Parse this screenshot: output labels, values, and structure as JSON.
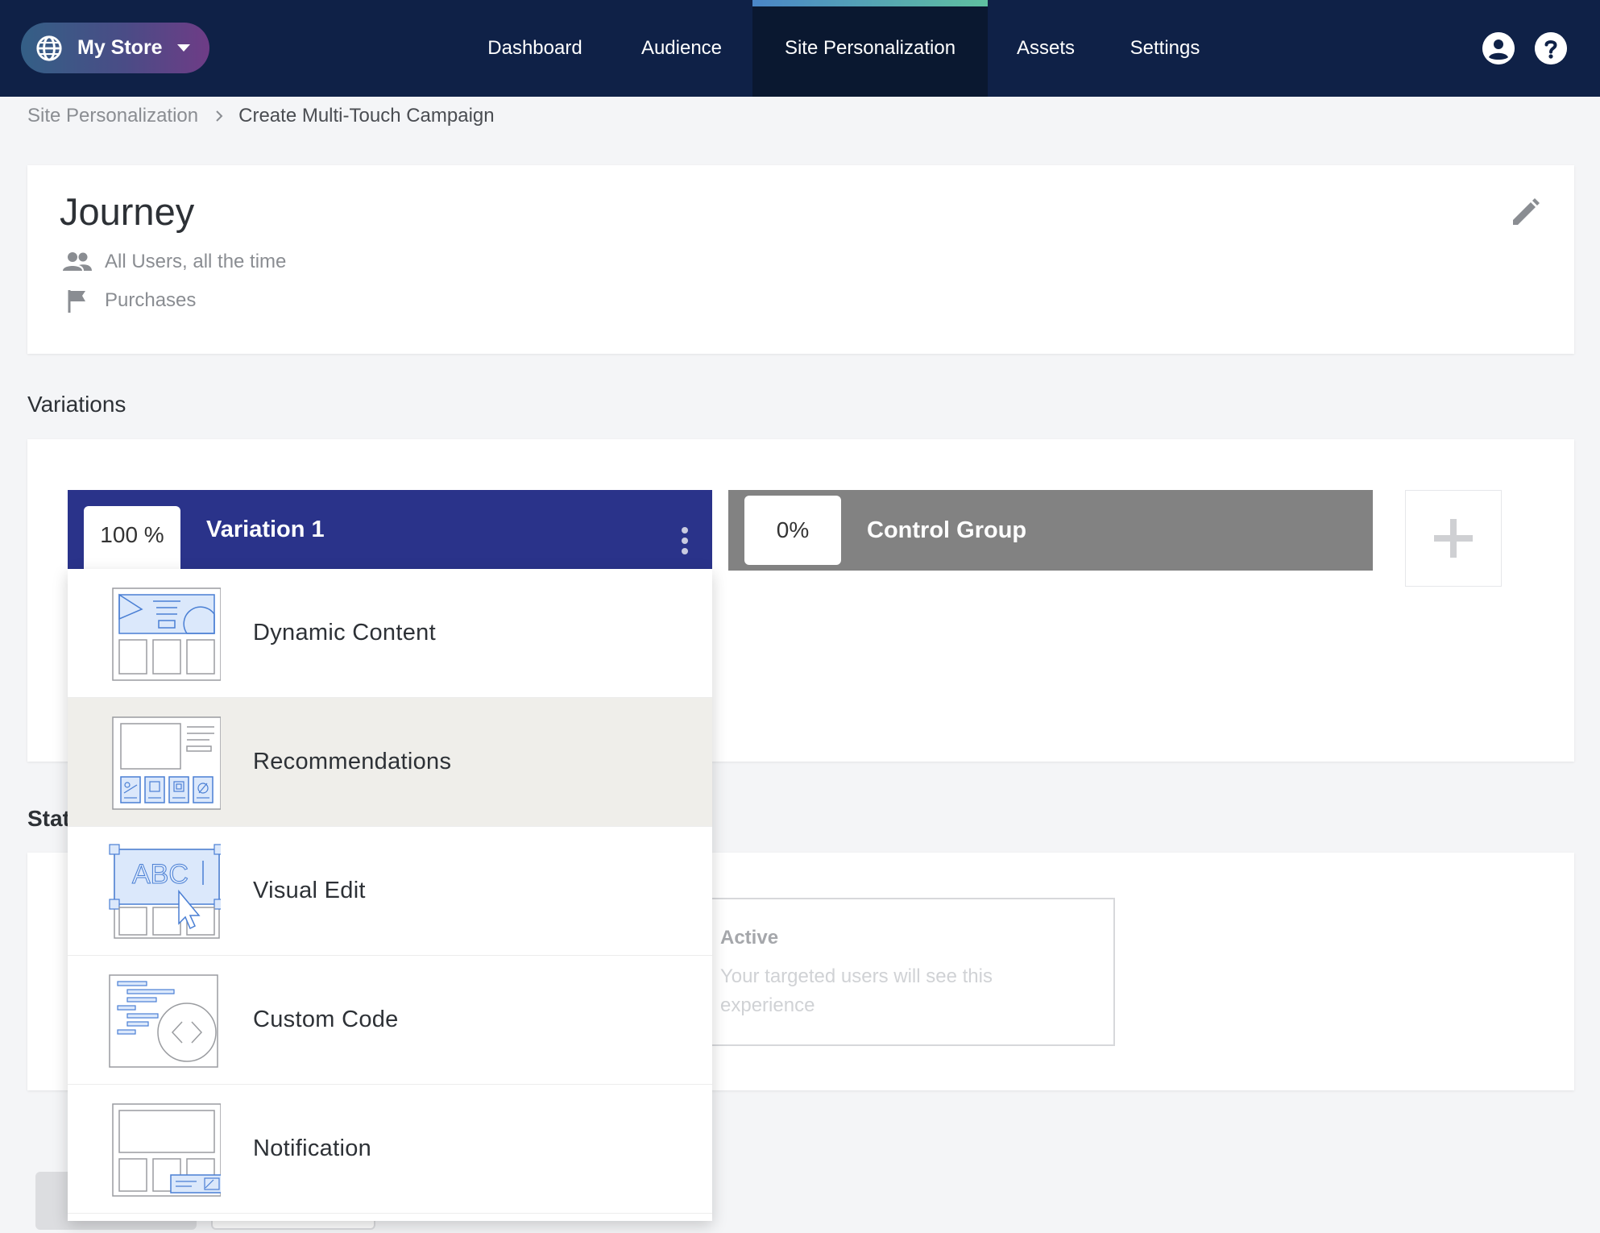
{
  "nav": {
    "store_name": "My Store",
    "tabs": [
      {
        "label": "Dashboard"
      },
      {
        "label": "Audience"
      },
      {
        "label": "Site Personalization"
      },
      {
        "label": "Assets"
      },
      {
        "label": "Settings"
      }
    ],
    "active_tab": "Site Personalization"
  },
  "breadcrumb": {
    "parent": "Site Personalization",
    "current": "Create Multi-Touch Campaign"
  },
  "journey": {
    "title": "Journey",
    "audience": "All Users, all the time",
    "goal": "Purchases"
  },
  "sections": {
    "variations": "Variations",
    "status": "Stat"
  },
  "variations": [
    {
      "percent": "100 %",
      "name": "Variation 1",
      "color": "#2a338a"
    },
    {
      "percent": "0%",
      "name": "Control Group",
      "color": "#828282"
    }
  ],
  "status_option": {
    "title": "Active",
    "description": "Your targeted users will see this experience"
  },
  "menu": {
    "items": [
      {
        "label": "Dynamic Content",
        "icon": "dynamic-content-icon"
      },
      {
        "label": "Recommendations",
        "icon": "recommendations-icon"
      },
      {
        "label": "Visual Edit",
        "icon": "visual-edit-icon"
      },
      {
        "label": "Custom Code",
        "icon": "custom-code-icon"
      },
      {
        "label": "Notification",
        "icon": "notification-icon"
      }
    ],
    "hovered": "Recommendations"
  },
  "colors": {
    "nav_bg": "#0f2147",
    "accent": "#2a338a",
    "control": "#828282",
    "icon_blue": "#4a7fd4"
  }
}
